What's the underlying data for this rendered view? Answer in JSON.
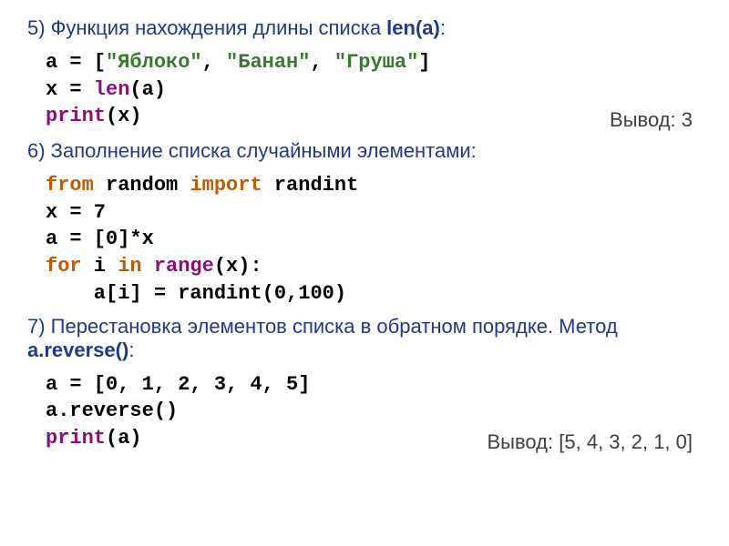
{
  "section5": {
    "heading_prefix": "5) Функция нахождения длины списка ",
    "heading_emph": "len(a)",
    "heading_suffix": ":",
    "code": {
      "l1_a": "a = [",
      "l1_s1": "\"Яблоко\"",
      "l1_c1": ", ",
      "l1_s2": "\"Банан\"",
      "l1_c2": ", ",
      "l1_s3": "\"Груша\"",
      "l1_b": "]",
      "l2_a": "x = ",
      "l2_fn": "len",
      "l2_b": "(a)",
      "l3_fn": "print",
      "l3_b": "(x)"
    },
    "output": "Вывод: 3"
  },
  "section6": {
    "heading": "6) Заполнение списка случайными элементами:",
    "code": {
      "l1_a": "from",
      "l1_b": " random ",
      "l1_c": "import",
      "l1_d": " randint",
      "l2": "x = 7",
      "l3": "a = [0]*x",
      "l4_a": "for",
      "l4_b": " i ",
      "l4_c": "in",
      "l4_d": " ",
      "l4_fn": "range",
      "l4_e": "(x):",
      "l5": "    a[i] = randint(0,100)"
    }
  },
  "section7": {
    "heading_prefix": "7) Перестановка элементов списка в обратном порядке. Метод ",
    "heading_emph": "a.reverse()",
    "heading_suffix": ":",
    "code": {
      "l1": "a = [0, 1, 2, 3, 4, 5]",
      "l2": "a.reverse()",
      "l3_fn": "print",
      "l3_b": "(a)"
    },
    "output": "Вывод: [5, 4, 3, 2, 1, 0]"
  }
}
